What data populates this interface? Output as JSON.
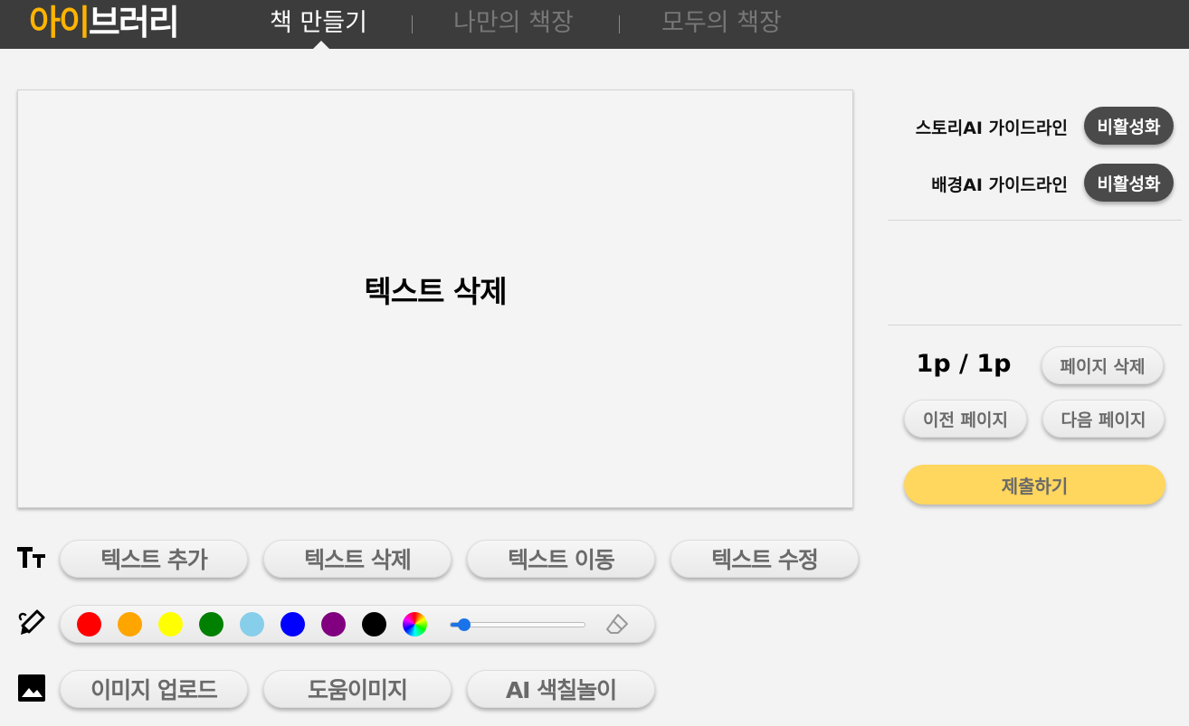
{
  "header": {
    "logo_part1": "아이",
    "logo_part2": "브러리",
    "tabs": [
      {
        "label": "책 만들기",
        "active": true
      },
      {
        "label": "나만의 책장",
        "active": false
      },
      {
        "label": "모두의 책장",
        "active": false
      }
    ]
  },
  "canvas": {
    "text": "텍스트 삭제"
  },
  "text_tools": {
    "icon": "text-size-icon",
    "buttons": [
      "텍스트 추가",
      "텍스트 삭제",
      "텍스트 이동",
      "텍스트 수정"
    ]
  },
  "draw_tools": {
    "icon": "brush-icon",
    "colors": [
      "#ff0000",
      "#ffa500",
      "#ffff00",
      "#008000",
      "#87ceeb",
      "#0000ff",
      "#800080",
      "#000000"
    ],
    "custom_color_icon": "color-wheel-icon",
    "brush_size_fraction": 0.08,
    "eraser_icon": "eraser-icon"
  },
  "image_tools": {
    "icon": "image-icon",
    "buttons": [
      "이미지 업로드",
      "도움이미지",
      "AI 색칠놀이"
    ]
  },
  "side_panel": {
    "story_guide_label": "스토리AI 가이드라인",
    "story_guide_toggle": "비활성화",
    "bg_guide_label": "배경AI 가이드라인",
    "bg_guide_toggle": "비활성화",
    "page_indicator": "1p / 1p",
    "delete_page": "페이지 삭제",
    "prev_page": "이전 페이지",
    "next_page": "다음 페이지",
    "submit": "제출하기"
  },
  "colors": {
    "brand_yellow": "#ffb400",
    "topbar": "#3c3c3c",
    "submit": "#ffd65e",
    "toggle": "#4a4a4a"
  }
}
